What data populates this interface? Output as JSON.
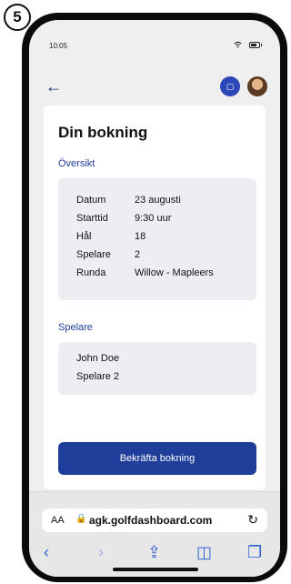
{
  "step_number": "5",
  "status_bar": {
    "time": "10:05"
  },
  "page": {
    "title": "Din bokning",
    "overview_label": "Översikt",
    "details": [
      {
        "key": "Datum",
        "value": "23 augusti"
      },
      {
        "key": "Starttid",
        "value": "9:30 uur"
      },
      {
        "key": "Hål",
        "value": "18"
      },
      {
        "key": "Spelare",
        "value": "2"
      },
      {
        "key": "Runda",
        "value": "Willow - Mapleers"
      }
    ],
    "players_label": "Spelare",
    "players": [
      "John Doe",
      "Spelare 2"
    ],
    "confirm_label": "Bekräfta bokning"
  },
  "browser": {
    "aa_label": "AA",
    "url": "agk.golfdashboard.com"
  },
  "colors": {
    "primary": "#1f3e9a",
    "accent": "#2b47b8",
    "browser_icon": "#2f62d6"
  },
  "icons": [
    "back-arrow-icon",
    "scan-icon",
    "avatar",
    "lock-icon",
    "reload-icon",
    "chevron-left-icon",
    "chevron-right-icon",
    "share-icon",
    "bookmarks-icon",
    "tabs-icon"
  ]
}
